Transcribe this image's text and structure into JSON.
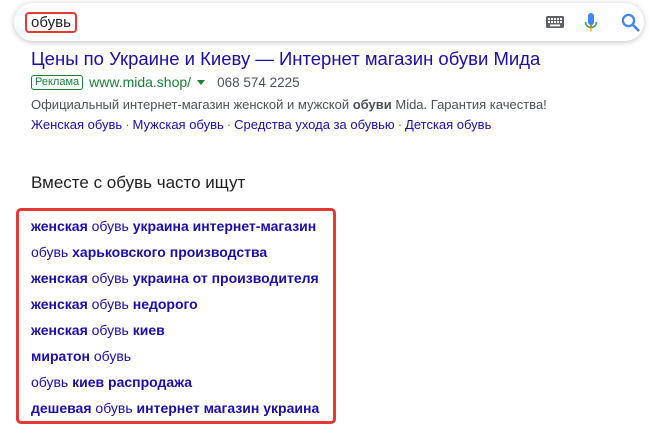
{
  "search": {
    "query": "обувь"
  },
  "icons": {
    "keyboard": "keyboard-icon",
    "mic": "mic-icon",
    "search": "search-icon"
  },
  "ad": {
    "title": "Цены по Украине и Киеву — Интернет магазин обуви Мида",
    "badge": "Реклама",
    "url": "www.mida.shop/",
    "phone": "068 574 2225",
    "description_before": "Официальный интернет-магазин женской и мужской ",
    "description_bold": "обуви",
    "description_after": " Mida. Гарантия качества!",
    "sitelinks": [
      "Женская обувь",
      "Мужская обувь",
      "Средства ухода за обувью",
      "Детская обувь"
    ],
    "separator": "·"
  },
  "related": {
    "heading": "Вместе с обувь часто ищут",
    "items": [
      {
        "pre": "женская",
        "mid": " обувь ",
        "post": "украина интернет-магазин"
      },
      {
        "pre": "",
        "mid": "обувь ",
        "post": "харьковского производства"
      },
      {
        "pre": "женская",
        "mid": " обувь ",
        "post": "украина от производителя"
      },
      {
        "pre": "женская",
        "mid": " обувь ",
        "post": "недорого"
      },
      {
        "pre": "женская",
        "mid": " обувь ",
        "post": "киев"
      },
      {
        "pre": "миратон",
        "mid": " обувь",
        "post": ""
      },
      {
        "pre": "",
        "mid": "обувь ",
        "post": "киев распродажа"
      },
      {
        "pre": "дешевая",
        "mid": " обувь ",
        "post": "интернет магазин украина"
      }
    ]
  },
  "colors": {
    "link": "#1a0dab",
    "green": "#188038",
    "highlight": "#e53935",
    "mic_blue": "#4285f4",
    "mic_red": "#ea4335"
  }
}
